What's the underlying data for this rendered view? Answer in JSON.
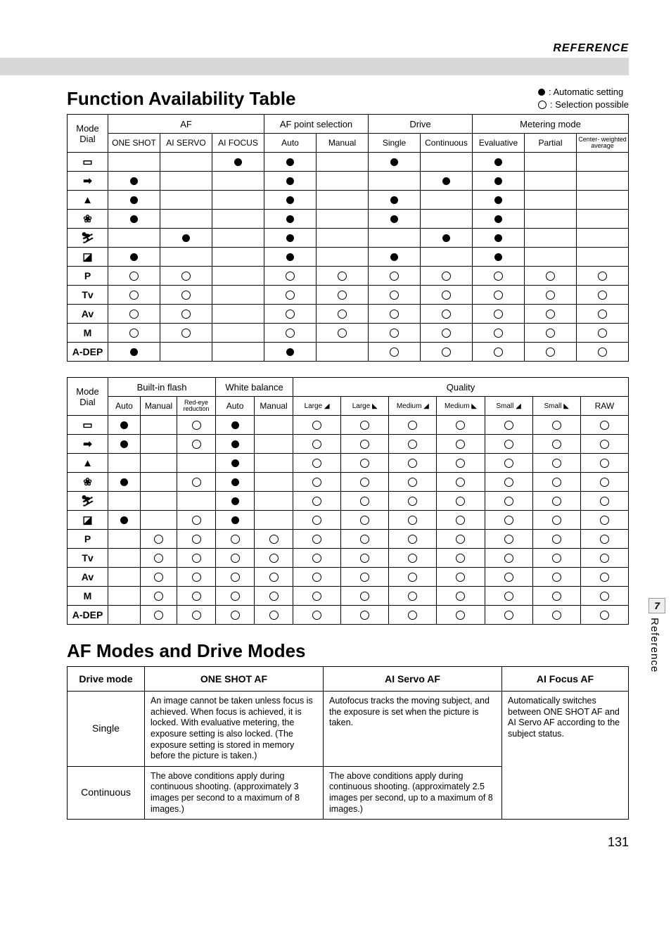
{
  "header": {
    "reference": "REFERENCE"
  },
  "title1": "Function Availability Table",
  "legend": {
    "auto": ": Automatic setting",
    "sel": ": Selection possible"
  },
  "modeDialLabel1": "Mode",
  "modeDialLabel2": "Dial",
  "t1": {
    "groups": {
      "af": "AF",
      "afp": "AF point selection",
      "drive": "Drive",
      "meter": "Metering mode"
    },
    "cols": {
      "oneshot": "ONE SHOT",
      "aiservo": "AI SERVO",
      "aifocus": "AI FOCUS",
      "auto": "Auto",
      "manual": "Manual",
      "single": "Single",
      "cont": "Continuous",
      "eval": "Evaluative",
      "partial": "Partial",
      "cwa": "Center-\nweighted\naverage"
    },
    "rows": [
      {
        "m": "▭",
        "v": [
          "",
          "",
          "d",
          "d",
          "",
          "d",
          "",
          "d",
          "",
          ""
        ]
      },
      {
        "m": "➡",
        "v": [
          "d",
          "",
          "",
          "d",
          "",
          "",
          "d",
          "d",
          "",
          ""
        ]
      },
      {
        "m": "▲",
        "v": [
          "d",
          "",
          "",
          "d",
          "",
          "d",
          "",
          "d",
          "",
          ""
        ]
      },
      {
        "m": "❀",
        "v": [
          "d",
          "",
          "",
          "d",
          "",
          "d",
          "",
          "d",
          "",
          ""
        ]
      },
      {
        "m": "⛷",
        "v": [
          "",
          "d",
          "",
          "d",
          "",
          "",
          "d",
          "d",
          "",
          ""
        ]
      },
      {
        "m": "◪",
        "v": [
          "d",
          "",
          "",
          "d",
          "",
          "d",
          "",
          "d",
          "",
          ""
        ]
      },
      {
        "m": "P",
        "v": [
          "c",
          "c",
          "",
          "c",
          "c",
          "c",
          "c",
          "c",
          "c",
          "c"
        ]
      },
      {
        "m": "Tv",
        "v": [
          "c",
          "c",
          "",
          "c",
          "c",
          "c",
          "c",
          "c",
          "c",
          "c"
        ]
      },
      {
        "m": "Av",
        "v": [
          "c",
          "c",
          "",
          "c",
          "c",
          "c",
          "c",
          "c",
          "c",
          "c"
        ]
      },
      {
        "m": "M",
        "v": [
          "c",
          "c",
          "",
          "c",
          "c",
          "c",
          "c",
          "c",
          "c",
          "c"
        ]
      },
      {
        "m": "A-DEP",
        "v": [
          "d",
          "",
          "",
          "d",
          "",
          "c",
          "c",
          "c",
          "c",
          "c"
        ]
      }
    ]
  },
  "t2": {
    "groups": {
      "flash": "Built-in flash",
      "wb": "White balance",
      "quality": "Quality"
    },
    "cols": {
      "fauto": "Auto",
      "fmanual": "Manual",
      "redeye": "Red-eye\nreduction",
      "wauto": "Auto",
      "wmanual": "Manual",
      "lf": "Large",
      "ln": "Large",
      "mf": "Medium",
      "mn": "Medium",
      "sf": "Small",
      "sn": "Small",
      "raw": "RAW"
    },
    "rows": [
      {
        "m": "▭",
        "v": [
          "d",
          "",
          "c",
          "d",
          "",
          "c",
          "c",
          "c",
          "c",
          "c",
          "c",
          "c"
        ]
      },
      {
        "m": "➡",
        "v": [
          "d",
          "",
          "c",
          "d",
          "",
          "c",
          "c",
          "c",
          "c",
          "c",
          "c",
          "c"
        ]
      },
      {
        "m": "▲",
        "v": [
          "",
          "",
          "",
          "d",
          "",
          "c",
          "c",
          "c",
          "c",
          "c",
          "c",
          "c"
        ]
      },
      {
        "m": "❀",
        "v": [
          "d",
          "",
          "c",
          "d",
          "",
          "c",
          "c",
          "c",
          "c",
          "c",
          "c",
          "c"
        ]
      },
      {
        "m": "⛷",
        "v": [
          "",
          "",
          "",
          "d",
          "",
          "c",
          "c",
          "c",
          "c",
          "c",
          "c",
          "c"
        ]
      },
      {
        "m": "◪",
        "v": [
          "d",
          "",
          "c",
          "d",
          "",
          "c",
          "c",
          "c",
          "c",
          "c",
          "c",
          "c"
        ]
      },
      {
        "m": "P",
        "v": [
          "",
          "c",
          "c",
          "c",
          "c",
          "c",
          "c",
          "c",
          "c",
          "c",
          "c",
          "c"
        ]
      },
      {
        "m": "Tv",
        "v": [
          "",
          "c",
          "c",
          "c",
          "c",
          "c",
          "c",
          "c",
          "c",
          "c",
          "c",
          "c"
        ]
      },
      {
        "m": "Av",
        "v": [
          "",
          "c",
          "c",
          "c",
          "c",
          "c",
          "c",
          "c",
          "c",
          "c",
          "c",
          "c"
        ]
      },
      {
        "m": "M",
        "v": [
          "",
          "c",
          "c",
          "c",
          "c",
          "c",
          "c",
          "c",
          "c",
          "c",
          "c",
          "c"
        ]
      },
      {
        "m": "A-DEP",
        "v": [
          "",
          "c",
          "c",
          "c",
          "c",
          "c",
          "c",
          "c",
          "c",
          "c",
          "c",
          "c"
        ]
      }
    ]
  },
  "title2": "AF Modes and Drive Modes",
  "t3": {
    "head": {
      "drive": "Drive mode",
      "one": "ONE SHOT AF",
      "servo": "AI Servo AF",
      "focus": "AI Focus AF"
    },
    "single": {
      "label": "Single",
      "one": "An image cannot be taken unless focus is achieved. When focus is achieved, it is locked. With evaluative metering, the exposure setting is also locked. (The exposure setting is stored in memory before the picture is taken.)",
      "servo": "Autofocus tracks the moving subject, and the exposure is set when the picture is taken.",
      "focus": "Automatically switches between ONE SHOT AF and AI Servo AF according to the subject status."
    },
    "cont": {
      "label": "Continuous",
      "one": "The above conditions apply during continuous shooting. (approximately 3 images per second to a maximum of 8 images.)",
      "servo": "The above conditions apply during continuous shooting. (approximately 2.5 images per second, up to a maximum of 8 images.)"
    }
  },
  "side": {
    "num": "7",
    "txt": "Reference"
  },
  "pageNumber": "131"
}
